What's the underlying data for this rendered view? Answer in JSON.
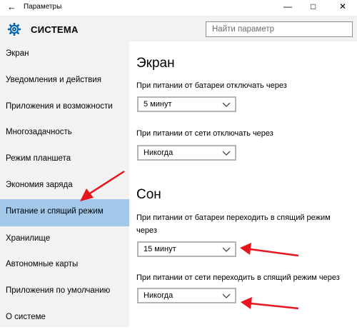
{
  "window": {
    "title": "Параметры",
    "controls": [
      "—",
      "□",
      "✕"
    ]
  },
  "header": {
    "title": "СИСТЕМА",
    "search_placeholder": "Найти параметр"
  },
  "sidebar": {
    "items": [
      {
        "label": "Экран",
        "selected": false
      },
      {
        "label": "Уведомления и действия",
        "selected": false
      },
      {
        "label": "Приложения и возможности",
        "selected": false
      },
      {
        "label": "Многозадачность",
        "selected": false
      },
      {
        "label": "Режим планшета",
        "selected": false
      },
      {
        "label": "Экономия заряда",
        "selected": false
      },
      {
        "label": "Питание и спящий режим",
        "selected": true
      },
      {
        "label": "Хранилище",
        "selected": false
      },
      {
        "label": "Автономные карты",
        "selected": false
      },
      {
        "label": "Приложения по умолчанию",
        "selected": false
      },
      {
        "label": "О системе",
        "selected": false
      }
    ]
  },
  "main": {
    "screen": {
      "heading": "Экран",
      "battery_label": "При питании от батареи отключать через",
      "battery_value": "5 минут",
      "ac_label": "При питании от сети отключать через",
      "ac_value": "Никогда"
    },
    "sleep": {
      "heading": "Сон",
      "battery_label_1": "При питании от батареи переходить в спящий режим",
      "battery_label_2": "через",
      "battery_value": "15 минут",
      "ac_label": "При питании от сети переходить в спящий режим через",
      "ac_value": "Никогда"
    }
  },
  "colors": {
    "accent": "#0063b1",
    "selection": "#a3c8ea",
    "sidebar_bg": "#f2f2f2",
    "annotation_arrow": "#e8141e"
  }
}
